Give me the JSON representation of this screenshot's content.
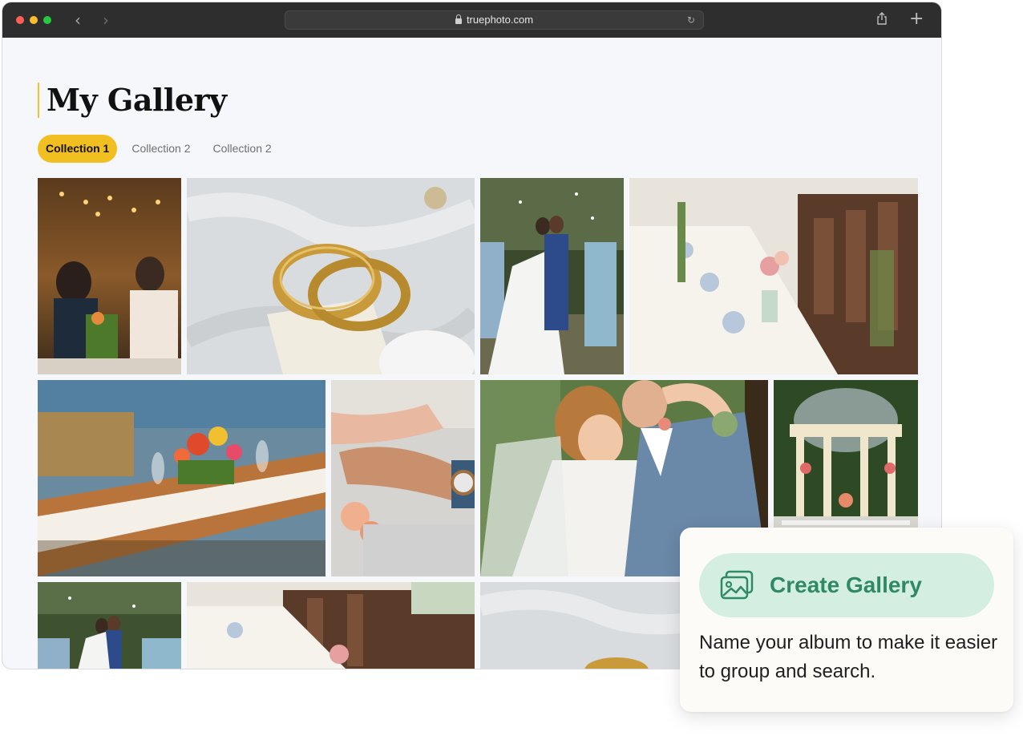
{
  "browser": {
    "url": "truephoto.com",
    "icons": [
      "back-arrow-icon",
      "forward-arrow-icon",
      "lock-icon",
      "reload-icon",
      "share-icon",
      "plus-icon"
    ]
  },
  "page": {
    "title": "My Gallery",
    "tabs": [
      {
        "label": "Collection 1",
        "active": true
      },
      {
        "label": "Collection 2",
        "active": false
      },
      {
        "label": "Collection 2",
        "active": false
      }
    ]
  },
  "card": {
    "button_label": "Create Gallery",
    "description": "Name your album to make it easier to group and search."
  },
  "colors": {
    "accent_yellow": "#f2bf22",
    "button_bg": "#d4efe2",
    "button_text": "#2f8a63",
    "titlebar": "#2e2e2e"
  }
}
